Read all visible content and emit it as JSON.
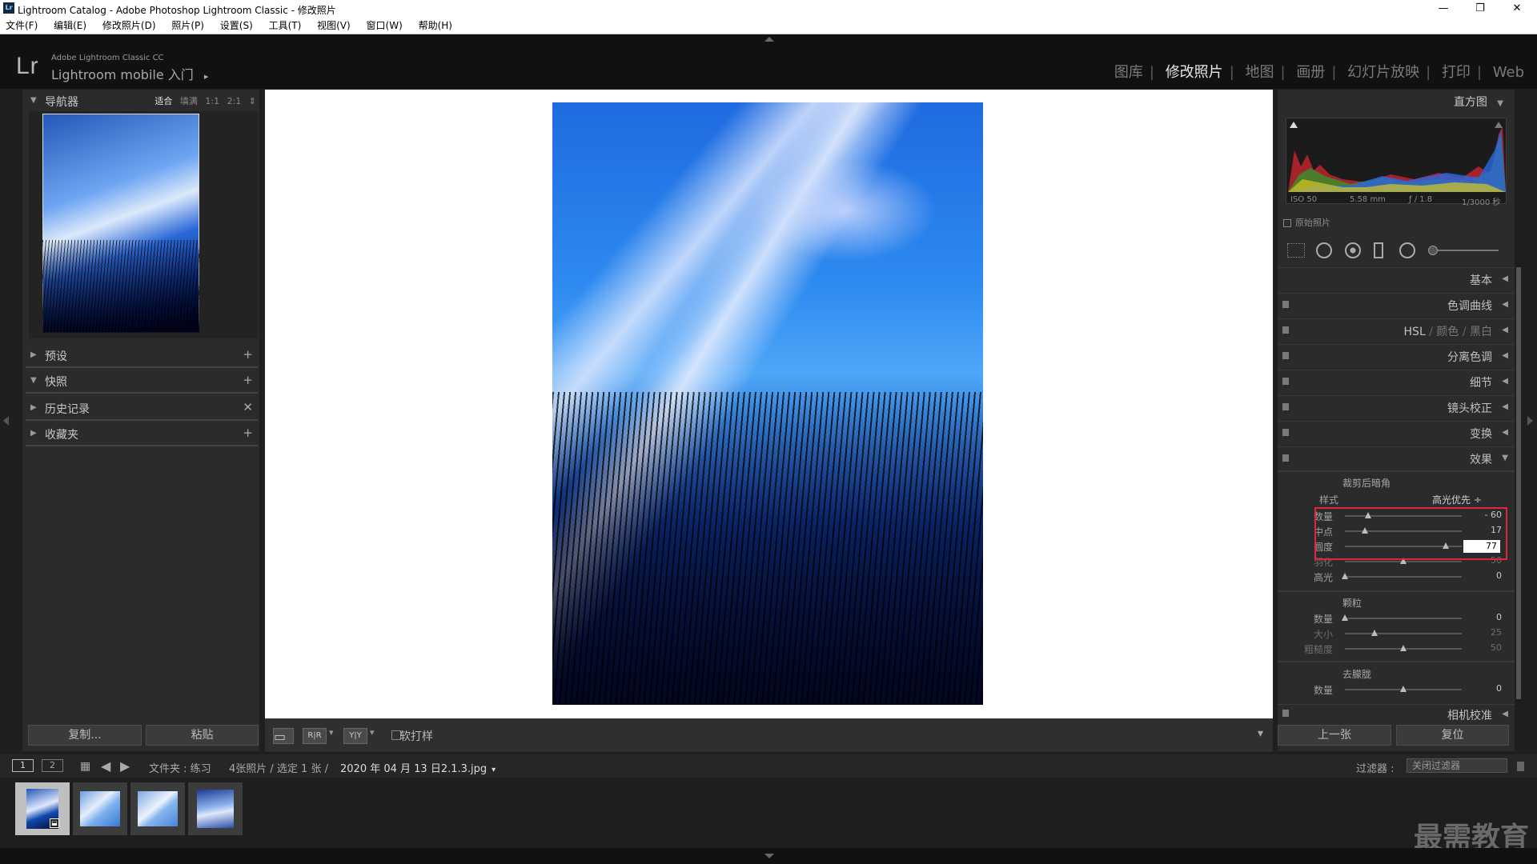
{
  "window": {
    "title": "Lightroom Catalog - Adobe Photoshop Lightroom Classic - 修改照片",
    "app_icon": "Lr",
    "controls": [
      "—",
      "❐",
      "✕"
    ]
  },
  "menu": [
    "文件(F)",
    "编辑(E)",
    "修改照片(D)",
    "照片(P)",
    "设置(S)",
    "工具(T)",
    "视图(V)",
    "窗口(W)",
    "帮助(H)"
  ],
  "identity": {
    "logo": "Lr",
    "brand_line1": "Adobe Lightroom Classic CC",
    "brand_line2": "Lightroom mobile 入门",
    "brand_arrow": "▸"
  },
  "modules": {
    "items": [
      "图库",
      "修改照片",
      "地图",
      "画册",
      "幻灯片放映",
      "打印",
      "Web"
    ],
    "active": "修改照片",
    "sep": "|"
  },
  "left_panel": {
    "navigator": {
      "label": "导航器",
      "options": [
        "适合",
        "填满",
        "1:1",
        "2:1"
      ],
      "selected": "适合",
      "spinner": "⇕"
    },
    "sections": [
      {
        "label": "预设",
        "action": "+",
        "open": false
      },
      {
        "label": "快照",
        "action": "+",
        "open": true
      },
      {
        "label": "历史记录",
        "action": "✕",
        "open": false
      },
      {
        "label": "收藏夹",
        "action": "+",
        "open": false
      }
    ],
    "copy_button": "复制...",
    "paste_button": "粘贴"
  },
  "toolbar": {
    "softproof_label": "软打样",
    "view_icons": [
      "▭",
      "R|R",
      "Y|Y"
    ],
    "dropdown": "▾"
  },
  "right_panel": {
    "histogram": {
      "title": "直方图"
    },
    "exif": {
      "iso": "ISO 50",
      "focal": "5.58 mm",
      "aperture": "ƒ / 1.8",
      "shutter": "1/3000 秒"
    },
    "original_photo_label": "原始照片",
    "sections": [
      "基本",
      "色调曲线",
      "分离色调",
      "细节",
      "镜头校正",
      "变换",
      "效果"
    ],
    "hsl": {
      "hsl": "HSL",
      "color": "颜色",
      "bw": "黑白",
      "sep": "/"
    },
    "effects": {
      "post_crop_vignette": {
        "title": "裁剪后暗角",
        "style_label": "样式",
        "style_value": "高光优先 ÷",
        "sliders": [
          {
            "label": "数量",
            "value": "- 60",
            "pos": 0.2
          },
          {
            "label": "中点",
            "value": "17",
            "pos": 0.17
          },
          {
            "label": "圆度",
            "value": "77",
            "pos": 0.86
          },
          {
            "label": "羽化",
            "value": "50",
            "pos": 0.5
          },
          {
            "label": "高光",
            "value": "0",
            "pos": 0.0
          }
        ]
      },
      "grain": {
        "title": "颗粒",
        "sliders": [
          {
            "label": "数量",
            "value": "0",
            "pos": 0.0
          },
          {
            "label": "大小",
            "value": "25",
            "pos": 0.25
          },
          {
            "label": "粗糙度",
            "value": "50",
            "pos": 0.5
          }
        ]
      },
      "dehaze": {
        "title": "去朦胧",
        "sliders": [
          {
            "label": "数量",
            "value": "0",
            "pos": 0.5
          }
        ]
      }
    },
    "camera_calibration": "相机校准",
    "prev_button": "上一张",
    "reset_button": "复位"
  },
  "filmstrip_bar": {
    "page1": "1",
    "page2": "2",
    "folder_label": "文件夹 : 练习",
    "count": "4张照片 / 选定 1 张 /",
    "filename": "2020 年 04 月 13 日2.1.3.jpg",
    "filter_label": "过滤器 :",
    "filter_value": "关闭过滤器"
  },
  "filmstrip": {
    "thumbnails": 4,
    "selected_index": 0
  },
  "watermark": "最需教育",
  "colors": {
    "accent_highlight": "#e0263a",
    "panel_bg": "#2b2b2b",
    "active_module": "#e8e8e8"
  }
}
